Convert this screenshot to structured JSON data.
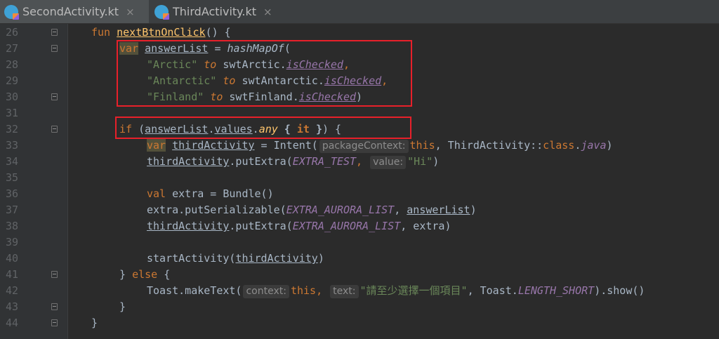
{
  "tabs": [
    {
      "label": "SecondActivity.kt",
      "active": true,
      "icon": "kotlin-file-icon"
    },
    {
      "label": "ThirdActivity.kt",
      "active": false,
      "icon": "kotlin-file-icon"
    }
  ],
  "close_glyph": "×",
  "lines": [
    {
      "n": "26",
      "fold": true
    },
    {
      "n": "27",
      "fold": true
    },
    {
      "n": "28",
      "fold": false
    },
    {
      "n": "29",
      "fold": false
    },
    {
      "n": "30",
      "fold": true
    },
    {
      "n": "31",
      "fold": false
    },
    {
      "n": "32",
      "fold": true
    },
    {
      "n": "33",
      "fold": false
    },
    {
      "n": "34",
      "fold": false
    },
    {
      "n": "35",
      "fold": false
    },
    {
      "n": "36",
      "fold": false
    },
    {
      "n": "37",
      "fold": false
    },
    {
      "n": "38",
      "fold": false
    },
    {
      "n": "39",
      "fold": false
    },
    {
      "n": "40",
      "fold": false
    },
    {
      "n": "41",
      "fold": true
    },
    {
      "n": "42",
      "fold": false
    },
    {
      "n": "43",
      "fold": true
    },
    {
      "n": "44",
      "fold": true
    }
  ],
  "code": {
    "l26": {
      "fun": "fun",
      "name": "nextBtnOnClick",
      "rest": "() {"
    },
    "l27": {
      "var": "var",
      "ident": "answerList",
      "eq": " = ",
      "call": "hashMapOf",
      "open": "("
    },
    "l28": {
      "str": "\"Arctic\"",
      "to": "to",
      "obj": "swtArctic.",
      "prop": "isChecked",
      "end": ","
    },
    "l29": {
      "str": "\"Antarctic\"",
      "to": "to",
      "obj": "swtAntarctic.",
      "prop": "isChecked",
      "end": ","
    },
    "l30": {
      "str": "\"Finland\"",
      "to": "to",
      "obj": "swtFinland.",
      "prop": "isChecked",
      "end": ")"
    },
    "l32": {
      "if": "if",
      "open": " (",
      "ident": "answerList",
      "dot": ".",
      "values": "values",
      "dot2": ".",
      "any": "any",
      "lambda_open": " { ",
      "it": "it",
      "lambda_close": " }",
      "end": ") {"
    },
    "l33": {
      "var": "var",
      "ident": "thirdActivity",
      "eq": " = Intent(",
      "hint": "packageContext:",
      "this": "this",
      "mid": ", ThirdActivity::",
      "cls": "class",
      "dot": ".",
      "java": "java",
      "end": ")"
    },
    "l34": {
      "ident": "thirdActivity",
      "call": ".putExtra(",
      "const": "EXTRA_TEST",
      "sep": ",",
      "hint": "value:",
      "str": "\"Hi\"",
      "end": ")"
    },
    "l36": {
      "val": "val",
      "rest": " extra = Bundle()"
    },
    "l37": {
      "pre": "extra.putSerializable(",
      "const": "EXTRA_AURORA_LIST",
      "sep": ", ",
      "ident": "answerList",
      "end": ")"
    },
    "l38": {
      "ident": "thirdActivity",
      "call": ".putExtra(",
      "const": "EXTRA_AURORA_LIST",
      "rest": ", extra)"
    },
    "l40": {
      "pre": "startActivity(",
      "ident": "thirdActivity",
      "end": ")"
    },
    "l41": {
      "pre": "} ",
      "else": "else",
      "end": " {"
    },
    "l42": {
      "pre": "Toast.makeText(",
      "hint1": "context:",
      "this": "this",
      "sep": ",",
      "hint2": "text:",
      "str": "\"請至少選擇一個項目\"",
      "mid": ", Toast.",
      "const": "LENGTH_SHORT",
      "end": ").show()"
    },
    "l43": {
      "text": "}"
    },
    "l44": {
      "text": "}"
    }
  },
  "colors": {
    "background": "#2b2b2b",
    "keyword": "#cc7832",
    "function": "#ffc66d",
    "string": "#6a8759",
    "property": "#9876aa",
    "highlight_box": "#e8202a"
  }
}
